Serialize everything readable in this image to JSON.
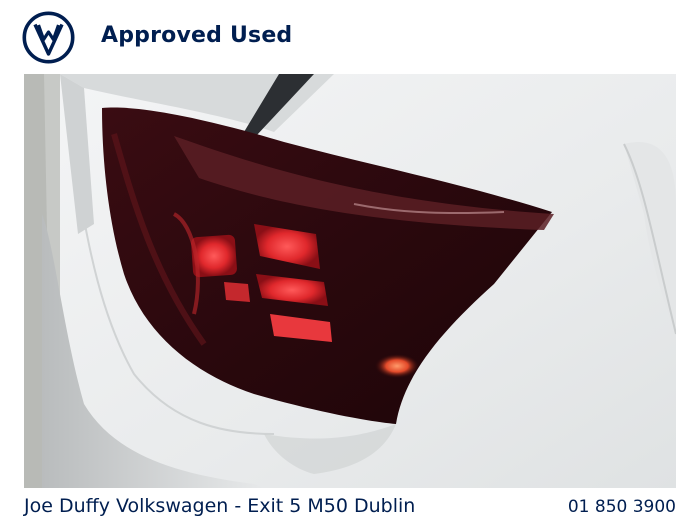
{
  "header": {
    "brand_text": "Approved Used",
    "logo_icon": "vw-logo-icon"
  },
  "photo": {
    "subject_icon": "car-taillight-photo"
  },
  "footer": {
    "dealer_text": "Joe Duffy Volkswagen - Exit 5 M50 Dublin",
    "phone_text": "01 850 3900"
  },
  "colors": {
    "brand_navy": "#001e50",
    "background": "#ffffff"
  }
}
